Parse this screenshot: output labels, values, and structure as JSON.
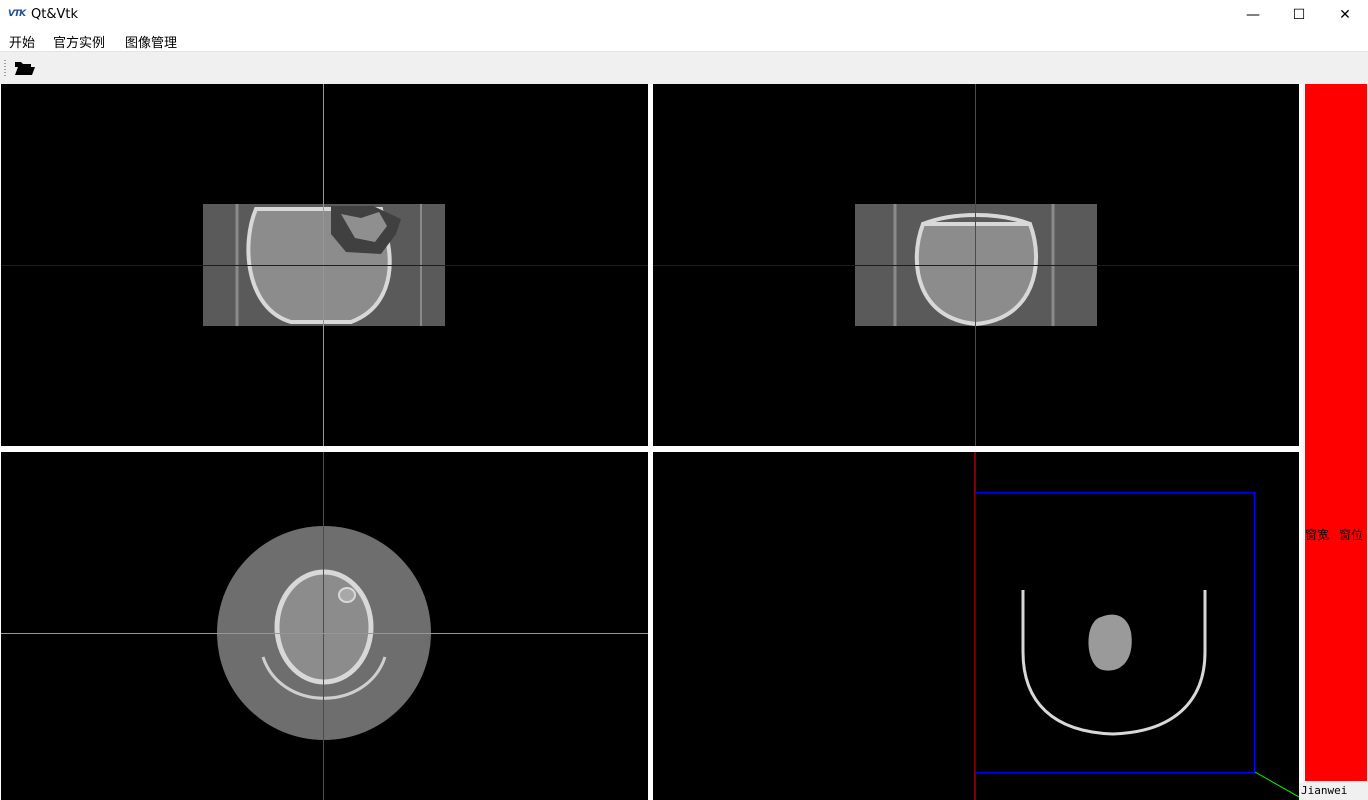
{
  "window": {
    "title": "Qt&Vtk",
    "icon": "vtk-logo-icon",
    "app_icon_text": "VTK",
    "minimize_glyph": "—",
    "maximize_glyph": "☐",
    "close_glyph": "✕"
  },
  "menu": {
    "items": [
      {
        "label": "开始"
      },
      {
        "label": "官方实例"
      },
      {
        "label": "图像管理"
      }
    ]
  },
  "toolbar": {
    "open_icon": "folder-open-icon"
  },
  "views": {
    "sagittal_cursor_vertical_color": "#00ff00",
    "sagittal_cursor_horizontal_color": "#0000ff",
    "coronal_cursor_vertical_color": "#ff0000",
    "coronal_cursor_horizontal_color": "#0000ff",
    "axial_cursor_vertical_color": "#ff0000",
    "axial_cursor_horizontal_color": "#00ff00",
    "volume_box_color": "#0000ff"
  },
  "sidebar": {
    "panel_color": "#ff0000",
    "window_width_label": "窗宽",
    "window_level_label": "窗位"
  },
  "status": {
    "text": "Jianwei"
  }
}
